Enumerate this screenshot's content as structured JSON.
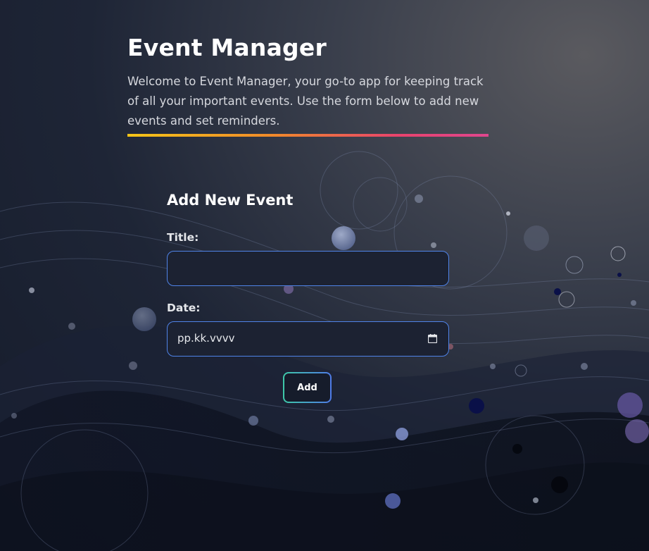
{
  "header": {
    "title": "Event Manager",
    "intro": "Welcome to Event Manager, your go-to app for keeping track of all your important events. Use the form below to add new events and set reminders."
  },
  "form": {
    "heading": "Add New Event",
    "title_label": "Title:",
    "title_value": "",
    "date_label": "Date:",
    "date_placeholder": "pp.kk.vvvv",
    "submit_label": "Add"
  },
  "icons": {
    "calendar": "calendar-icon"
  },
  "colors": {
    "input_border": "#4f83e8",
    "accent_gradient_start": "#f5c518",
    "accent_gradient_end": "#e0468e",
    "button_border_start": "#3ec9a8",
    "button_border_end": "#4f7be8"
  }
}
